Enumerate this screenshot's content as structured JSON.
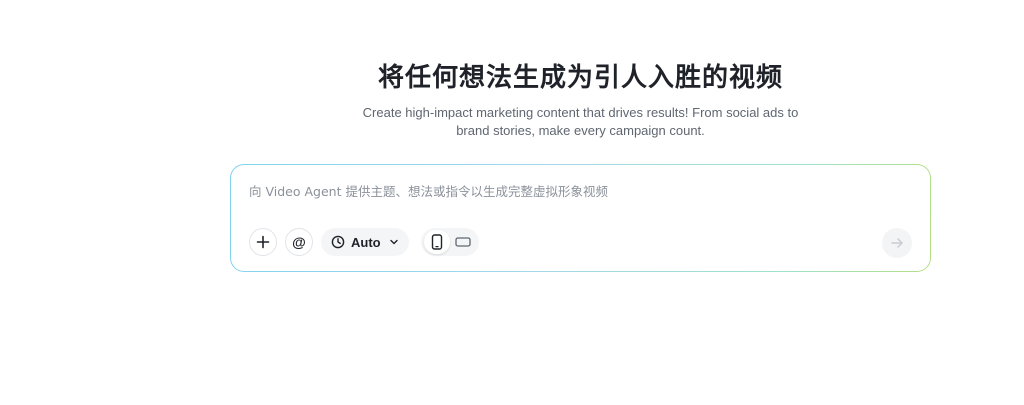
{
  "hero": {
    "title": "将任何想法生成为引人入胜的视频",
    "subtitle": "Create high-impact marketing content that drives results! From social ads to brand stories, make every campaign count."
  },
  "prompt": {
    "placeholder": "向 Video Agent 提供主题、想法或指令以生成完整虚拟形象视频",
    "value": ""
  },
  "toolbar": {
    "add_icon": "plus-icon",
    "mention_label": "@",
    "duration": {
      "icon": "clock-icon",
      "label": "Auto",
      "chevron": "chevron-down-icon"
    },
    "aspect_ratio": {
      "options": [
        "portrait",
        "landscape"
      ],
      "selected": "portrait"
    },
    "send_icon": "arrow-right-icon"
  },
  "colors": {
    "title": "#1f2329",
    "subtitle": "#5f6670",
    "placeholder": "#8b919a",
    "border_gradient_start": "#7fd3ee",
    "border_gradient_end": "#b5df84",
    "pill_bg": "#f4f5f7",
    "send_disabled": "#c9ccd1"
  }
}
